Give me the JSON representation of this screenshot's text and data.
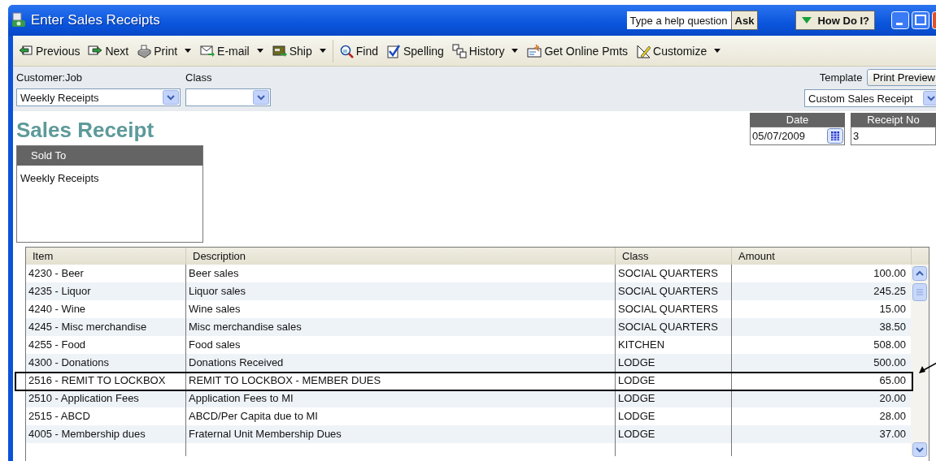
{
  "window": {
    "title": "Enter Sales Receipts"
  },
  "help": {
    "placeholder": "Type a help question",
    "ask_button": "Ask",
    "how_do_i_button": "How Do I?"
  },
  "toolbar": [
    {
      "label": "Previous",
      "dropdown": false,
      "separator_before": false
    },
    {
      "label": "Next",
      "dropdown": false,
      "separator_before": false
    },
    {
      "label": "Print",
      "dropdown": true,
      "separator_before": false
    },
    {
      "label": "E-mail",
      "dropdown": true,
      "separator_before": false
    },
    {
      "label": "Ship",
      "dropdown": true,
      "separator_before": false
    },
    {
      "label": "Find",
      "dropdown": false,
      "separator_before": true
    },
    {
      "label": "Spelling",
      "dropdown": false,
      "separator_before": false
    },
    {
      "label": "History",
      "dropdown": true,
      "separator_before": false
    },
    {
      "label": "Get Online Pmts",
      "dropdown": false,
      "separator_before": false
    },
    {
      "label": "Customize",
      "dropdown": true,
      "separator_before": false
    }
  ],
  "header": {
    "customer_job": {
      "label": "Customer:Job",
      "value": "Weekly Receipts"
    },
    "class": {
      "label": "Class"
    },
    "template": {
      "label": "Template",
      "print_preview_button": "Print Preview",
      "value": "Custom Sales Receipt"
    }
  },
  "receipt": {
    "heading": "Sales Receipt",
    "sold_to": {
      "label": "Sold To",
      "value": "Weekly Receipts"
    },
    "date": {
      "label": "Date",
      "value": "05/07/2009"
    },
    "receipt_no": {
      "label": "Receipt No",
      "value": "3"
    }
  },
  "table": {
    "columns": [
      "Item",
      "Description",
      "Class",
      "Amount"
    ],
    "rows": [
      {
        "item": "4230 - Beer",
        "description": "Beer sales",
        "class": "SOCIAL QUARTERS",
        "amount": "100.00",
        "highlighted": false
      },
      {
        "item": "4235 - Liquor",
        "description": "Liquor sales",
        "class": "SOCIAL QUARTERS",
        "amount": "245.25",
        "highlighted": false
      },
      {
        "item": "4240 - Wine",
        "description": "Wine sales",
        "class": "SOCIAL QUARTERS",
        "amount": "15.00",
        "highlighted": false
      },
      {
        "item": "4245 - Misc merchandise",
        "description": "Misc merchandise sales",
        "class": "SOCIAL QUARTERS",
        "amount": "38.50",
        "highlighted": false
      },
      {
        "item": "4255 - Food",
        "description": "Food sales",
        "class": "KITCHEN",
        "amount": "508.00",
        "highlighted": false
      },
      {
        "item": "4300 - Donations",
        "description": "Donations Received",
        "class": "LODGE",
        "amount": "500.00",
        "highlighted": false
      },
      {
        "item": "2516 - REMIT TO LOCKBOX",
        "description": "REMIT TO LOCKBOX - MEMBER DUES",
        "class": "LODGE",
        "amount": "65.00",
        "highlighted": true
      },
      {
        "item": "2510 - Application Fees",
        "description": "Application Fees to MI",
        "class": "LODGE",
        "amount": "20.00",
        "highlighted": false
      },
      {
        "item": "2515 - ABCD",
        "description": "ABCD/Per Capita due to MI",
        "class": "LODGE",
        "amount": "28.00",
        "highlighted": false
      },
      {
        "item": "4005 - Membership dues",
        "description": "Fraternal Unit Membership Dues",
        "class": "LODGE",
        "amount": "37.00",
        "highlighted": false
      }
    ]
  }
}
